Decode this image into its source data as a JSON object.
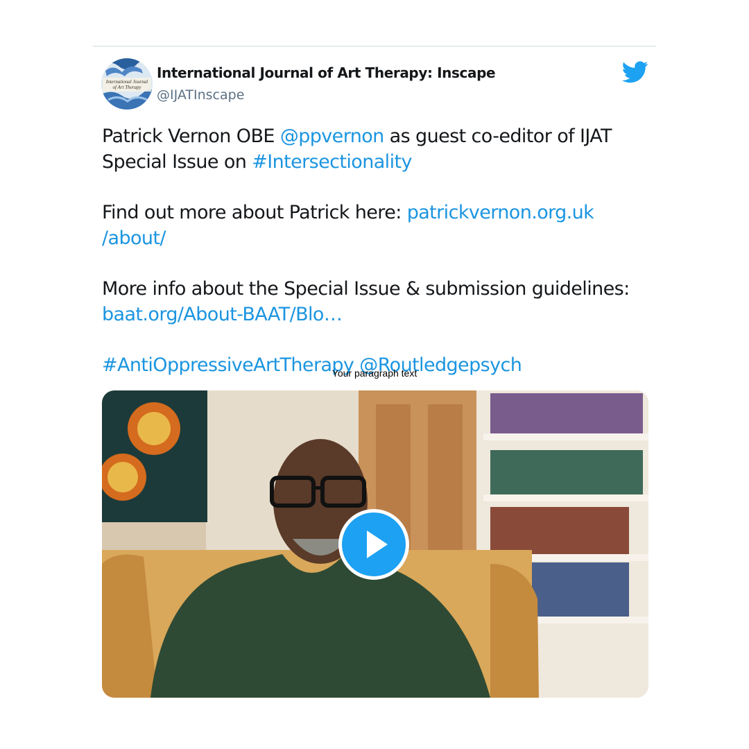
{
  "author": {
    "display_name": "International Journal of Art Therapy: Inscape",
    "handle": "@IJATInscape",
    "avatar_text_line1": "International Journal",
    "avatar_text_line2": "of Art Therapy"
  },
  "brand_icon": "twitter-bird-icon",
  "colors": {
    "link": "#1b95e0",
    "twitter_blue": "#1da1f2",
    "text": "#14171a",
    "muted": "#5b7083"
  },
  "tweet": {
    "p1": {
      "t1": "Patrick Vernon OBE ",
      "mention1": "@ppvernon",
      "t2": " as guest co-editor of IJAT Special Issue on ",
      "hashtag1": "#Intersectionality"
    },
    "p2": {
      "t1": "Find out more about Patrick here: ",
      "link_a": "patrickvernon.org.uk",
      "link_b": "/about/"
    },
    "p3": {
      "t1": "More info about the Special Issue & submission guidelines: ",
      "link": "baat.org/About-BAAT/Blo…"
    },
    "p4": {
      "hashtag": "#AntiOppressiveArtTherapy",
      "space": " ",
      "mention": "@Routledgepsych"
    }
  },
  "overlay_caption": "Your paragraph text",
  "media": {
    "type": "video",
    "play_icon": "play-icon"
  }
}
